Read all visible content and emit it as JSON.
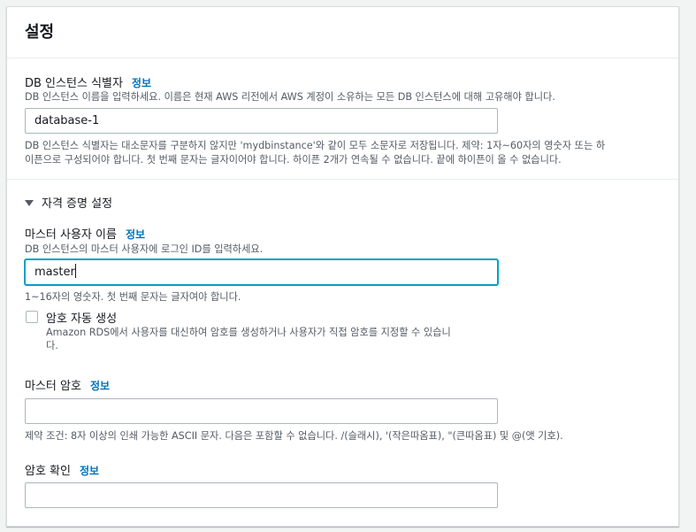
{
  "panel": {
    "title": "설정"
  },
  "db_identifier": {
    "label": "DB 인스턴스 식별자",
    "info": "정보",
    "description": "DB 인스턴스 이름을 입력하세요. 이름은 현재 AWS 리전에서 AWS 계정이 소유하는 모든 DB 인스턴스에 대해 고유해야 합니다.",
    "value": "database-1",
    "constraint_line1": "DB 인스턴스 식별자는 대소문자를 구분하지 않지만 'mydbinstance'와 같이 모두 소문자로 저장됩니다. 제약: 1자~60자의 영숫자 또는 하",
    "constraint_line2": "이픈으로 구성되어야 합니다. 첫 번째 문자는 글자이어야 합니다. 하이픈 2개가 연속될 수 없습니다. 끝에 하이픈이 올 수 없습니다."
  },
  "credentials": {
    "section_title": "자격 증명 설정",
    "master_username": {
      "label": "마스터 사용자 이름",
      "info": "정보",
      "description": "DB 인스턴스의 마스터 사용자에 로그인 ID를 입력하세요.",
      "value": "master",
      "constraint": "1~16자의 영숫자. 첫 번째 문자는 글자여야 합니다."
    },
    "auto_password": {
      "label": "암호 자동 생성",
      "description_line1": "Amazon RDS에서 사용자를 대신하여 암호를 생성하거나 사용자가 직접 암호를 지정할 수 있습니",
      "description_line2": "다.",
      "checked": false
    },
    "master_password": {
      "label": "마스터 암호",
      "info": "정보",
      "value": "",
      "constraint": "제약 조건: 8자 이상의 인쇄 가능한 ASCII 문자. 다음은 포함할 수 없습니다. /(슬래시), '(작은따옴표), \"(큰따옴표) 및 @(앳 기호)."
    },
    "confirm_password": {
      "label": "암호 확인",
      "info": "정보",
      "value": ""
    }
  }
}
